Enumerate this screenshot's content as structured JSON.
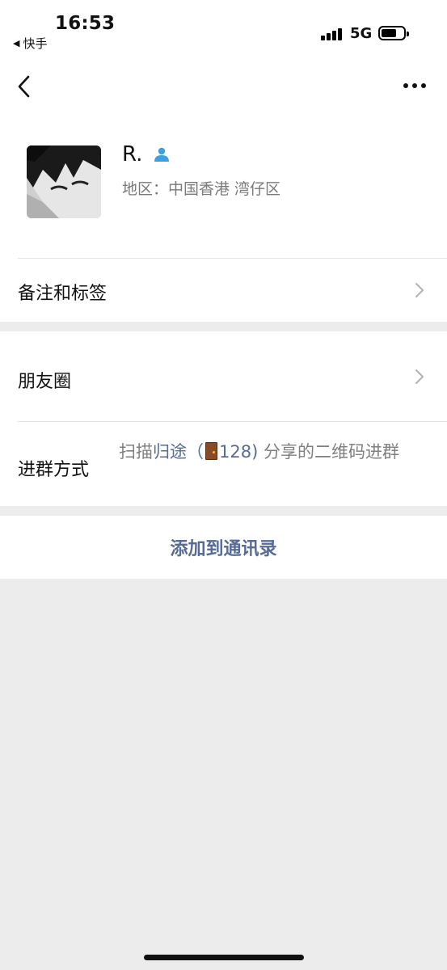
{
  "status_bar": {
    "time": "16:53",
    "back_app": "快手",
    "network": "5G",
    "icons": [
      "signal-icon",
      "battery-icon"
    ]
  },
  "nav": {
    "back_icon": "chevron-left-icon",
    "more_icon": "ellipsis-icon"
  },
  "profile": {
    "name": "R.",
    "name_icon": "person-icon",
    "region": "地区：中国香港 湾仔区"
  },
  "rows": {
    "remark_label": "备注和标签",
    "moments_label": "朋友圈",
    "join_label": "进群方式",
    "join_prefix": "扫描",
    "join_link": "归途（",
    "join_emoji": "door-icon",
    "join_link_suffix": "128)",
    "join_suffix": " 分享的二维码进群"
  },
  "actions": {
    "add_contact": "添加到通讯录"
  },
  "colors": {
    "link": "#576b95",
    "background": "#ececec",
    "person_icon": "#3aa0e0"
  }
}
